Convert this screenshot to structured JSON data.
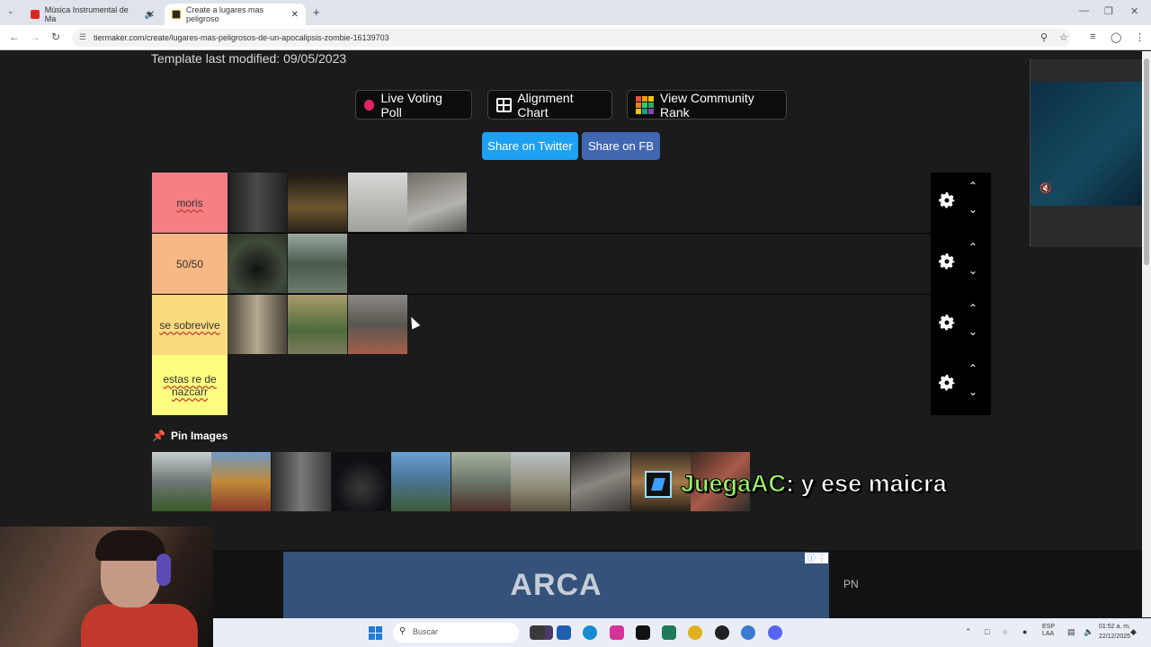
{
  "browser": {
    "tabs": [
      {
        "title": "Música Instrumental de Ma",
        "favicon_color": "#e02424"
      },
      {
        "title": "Create a lugares mas peligroso",
        "favicon_color": "#2a2a2a"
      }
    ],
    "new_tab": "+",
    "url": "tiermaker.com/create/lugares-mas-peligrosos-de-un-apocalipsis-zombie-16139703"
  },
  "page": {
    "modified": "Template last modified: 09/05/2023",
    "buttons": {
      "live_voting": "Live Voting Poll",
      "alignment": "Alignment Chart",
      "community": "View Community Rank"
    },
    "share": {
      "twitter": "Share on Twitter",
      "fb": "Share on FB"
    },
    "tiers": [
      {
        "label": "moris",
        "color": "#f47f84",
        "images": [
          "#2d2d2d",
          "#5a4a2c",
          "#b7b8b5",
          "#8c8c8a"
        ]
      },
      {
        "label": "50/50",
        "color": "#f7b885",
        "images": [
          "#3f4a39",
          "#6b7a6a"
        ]
      },
      {
        "label": "se sobrevive",
        "color": "#fadb7f",
        "images": [
          "#8e8474",
          "#7c7a5b",
          "#6d6a63"
        ]
      },
      {
        "label": "estas re de nazcarr",
        "color": "#fdfc7f",
        "images": []
      }
    ],
    "pin": {
      "label": "Pin Images",
      "images": [
        "#9aa1a0",
        "#c08a3a",
        "#5b5b5b",
        "#0f0f14",
        "#4f7aa1",
        "#6a7768",
        "#8f8a76",
        "#5a5652",
        "#5b4b3a",
        "#8a5a48"
      ]
    }
  },
  "stream": {
    "chat_user": "JuegaAC",
    "chat_msg": ": y ese maicra"
  },
  "ad": {
    "banner": "ARCA",
    "side": "PN"
  },
  "taskbar": {
    "search": "Buscar",
    "lang": "ESP\nLAA",
    "time": "01:52 a. m.",
    "date": "22/12/2025"
  }
}
